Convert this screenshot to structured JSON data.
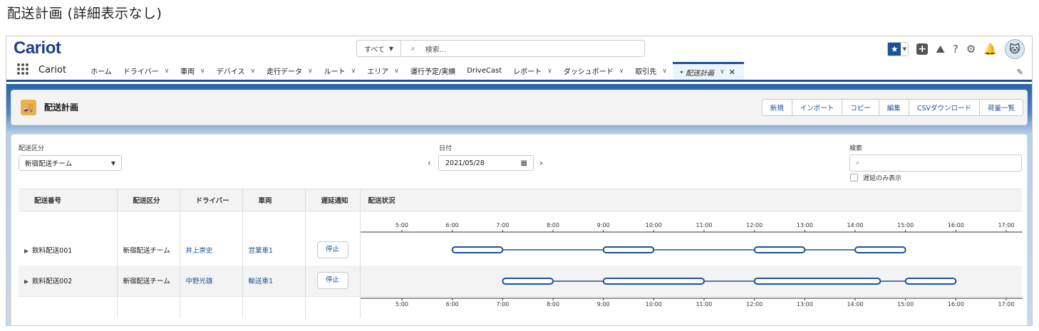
{
  "caption": "配送計画 (詳細表示なし)",
  "logo": {
    "part1": "Car",
    "part2": "iot"
  },
  "search": {
    "scope": "すべて",
    "placeholder": "検索..."
  },
  "app_name": "Cariot",
  "nav": {
    "items": [
      {
        "label": "ホーム",
        "dropdown": false
      },
      {
        "label": "ドライバー",
        "dropdown": true
      },
      {
        "label": "車両",
        "dropdown": true
      },
      {
        "label": "デバイス",
        "dropdown": true
      },
      {
        "label": "走行データ",
        "dropdown": true
      },
      {
        "label": "ルート",
        "dropdown": true
      },
      {
        "label": "エリア",
        "dropdown": true
      },
      {
        "label": "運行予定/実績",
        "dropdown": false
      },
      {
        "label": "DriveCast",
        "dropdown": false
      },
      {
        "label": "レポート",
        "dropdown": true
      },
      {
        "label": "ダッシュボード",
        "dropdown": true
      },
      {
        "label": "取引先",
        "dropdown": true
      }
    ],
    "active_tab": "* 配送計画"
  },
  "page_header": {
    "title": "配送計画",
    "actions": [
      "新規",
      "インポート",
      "コピー",
      "編集",
      "CSVダウンロード",
      "荷量一覧"
    ]
  },
  "filters": {
    "category_label": "配送区分",
    "category_value": "新宿配送チーム",
    "date_label": "日付",
    "date_value": "2021/05/28",
    "search_label": "検索",
    "delay_only_label": "遅延のみ表示",
    "delay_only_checked": false
  },
  "table": {
    "columns": [
      "配送番号",
      "配送区分",
      "ドライバー",
      "車両",
      "遅延通知",
      "配送状況"
    ],
    "ticks": [
      "5:00",
      "6:00",
      "7:00",
      "8:00",
      "9:00",
      "10:00",
      "11:00",
      "12:00",
      "13:00",
      "14:00",
      "15:00",
      "16:00",
      "17:00"
    ],
    "tick_hours": [
      5,
      6,
      7,
      8,
      9,
      10,
      11,
      12,
      13,
      14,
      15,
      16,
      17
    ],
    "rows": [
      {
        "id": "飲料配送001",
        "category": "新宿配送チーム",
        "driver": "井上崇史",
        "vehicle": "営業車1",
        "notify_button": "停止",
        "segments": [
          [
            6,
            7
          ],
          [
            9,
            10
          ],
          [
            12,
            13
          ],
          [
            14,
            15
          ]
        ]
      },
      {
        "id": "飲料配送002",
        "category": "新宿配送チーム",
        "driver": "中野光雄",
        "vehicle": "輸送車1",
        "notify_button": "停止",
        "segments": [
          [
            7,
            8
          ],
          [
            9,
            11
          ],
          [
            12,
            14.5
          ],
          [
            15,
            16
          ]
        ]
      }
    ]
  },
  "colors": {
    "brand": "#1b5297",
    "segment": "#1b5297",
    "folder_icon": "#e5b54c"
  }
}
